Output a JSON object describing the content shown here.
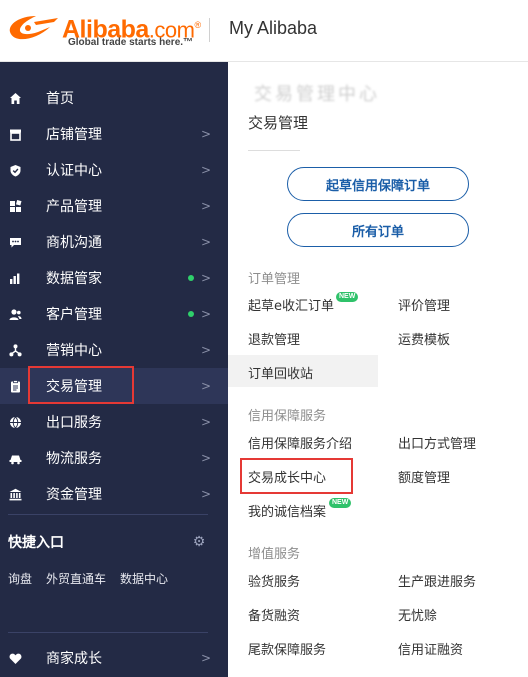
{
  "header": {
    "logo_text": "Alibaba",
    "logo_suffix": ".com",
    "logo_reg": "®",
    "logo_tagline": "Global trade starts here.™",
    "title": "My Alibaba"
  },
  "sidebar": {
    "items": [
      {
        "label": "首页",
        "icon": "home-icon"
      },
      {
        "label": "店铺管理",
        "icon": "store-icon",
        "arrow": ">"
      },
      {
        "label": "认证中心",
        "icon": "shield-check-icon",
        "arrow": ">"
      },
      {
        "label": "产品管理",
        "icon": "grid-icon",
        "arrow": ">"
      },
      {
        "label": "商机沟通",
        "icon": "chat-icon",
        "arrow": ">"
      },
      {
        "label": "数据管家",
        "icon": "bar-chart-icon",
        "arrow": ">"
      },
      {
        "label": "客户管理",
        "icon": "users-icon",
        "arrow": ">"
      },
      {
        "label": "营销中心",
        "icon": "share-icon",
        "arrow": ">"
      },
      {
        "label": "交易管理",
        "icon": "clipboard-icon",
        "arrow": ">"
      },
      {
        "label": "出口服务",
        "icon": "globe-icon",
        "arrow": ">"
      },
      {
        "label": "物流服务",
        "icon": "truck-icon",
        "arrow": ">"
      },
      {
        "label": "资金管理",
        "icon": "bank-icon",
        "arrow": ">"
      }
    ],
    "quick_title": "快捷入口",
    "quick_links": [
      "询盘",
      "外贸直通车",
      "数据中心"
    ],
    "bottom_item": {
      "label": "商家成长",
      "icon": "heart-icon",
      "arrow": ">"
    }
  },
  "panel": {
    "ghost_text": "交易管理中心",
    "title": "交易管理",
    "buttons": {
      "draft_order": "起草信用保障订单",
      "all_orders": "所有订单"
    },
    "sections": {
      "orders": {
        "title": "订单管理",
        "links": {
          "draft_ecollect": "起草e收汇订单",
          "review": "评价管理",
          "refund": "退款管理",
          "shipping_template": "运费模板",
          "recycle": "订单回收站"
        }
      },
      "credit": {
        "title": "信用保障服务",
        "links": {
          "intro": "信用保障服务介绍",
          "export_method": "出口方式管理",
          "growth_center": "交易成长中心",
          "quota": "额度管理",
          "integrity_profile": "我的诚信档案"
        }
      },
      "value_added": {
        "title": "增值服务",
        "links": {
          "inspection": "验货服务",
          "production_tracking": "生产跟进服务",
          "stock_finance": "备货融资",
          "worry_free": "无忧赊",
          "balance_guarantee": "尾款保障服务",
          "credit_finance": "信用证融资"
        }
      }
    },
    "new_badge": "NEW"
  },
  "colors": {
    "brand_orange": "#ff6a00",
    "sidebar_bg": "#232a45",
    "pill_blue": "#1b5ea8",
    "highlight_red": "#e53935",
    "dot_green": "#2fd06b"
  }
}
